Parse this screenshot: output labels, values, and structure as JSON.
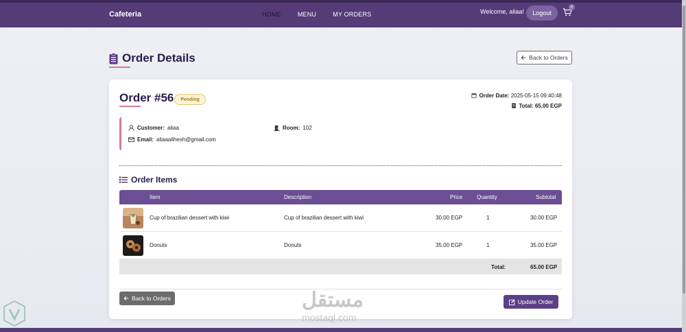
{
  "nav": {
    "brand": "Cafeteria",
    "links": [
      "HOME",
      "MENU",
      "MY ORDERS"
    ],
    "welcome": "Welcome, aliaa!",
    "logout": "Logout",
    "cart_count": "0"
  },
  "page": {
    "title": "Order Details",
    "back_label": "Back to Orders"
  },
  "order": {
    "title": "Order #56",
    "status": "Pending",
    "date_label": "Order Date:",
    "date_value": "2025-05-15 09:40:48",
    "total_label": "Total:",
    "total_value": "65.00 EGP",
    "customer_label": "Customer:",
    "customer_value": "aliaa",
    "room_label": "Room:",
    "room_value": "102",
    "email_label": "Email:",
    "email_value": "aliaaalihesh@gmail.com"
  },
  "items_section": {
    "title": "Order Items",
    "headers": [
      "Item",
      "Description",
      "Price",
      "Quantity",
      "Subtotal"
    ],
    "rows": [
      {
        "name": "Cup of brazilian dessert with kiwi",
        "description": "Cup of brazilian dessert with kiwi",
        "price": "30.00 EGP",
        "quantity": "1",
        "subtotal": "30.00 EGP"
      },
      {
        "name": "Donuts",
        "description": "Donuts",
        "price": "35.00 EGP",
        "quantity": "1",
        "subtotal": "35.00 EGP"
      }
    ],
    "total_label": "Total:",
    "total_value": "65.00 EGP"
  },
  "actions": {
    "back_label": "Back to Orders",
    "update_label": "Update Order"
  },
  "watermark": {
    "text": "مستقل",
    "sub": "mostaql.com"
  },
  "colors": {
    "navbar": "#553b78",
    "accent": "#d97a9a",
    "table_header": "#6b4e93",
    "update_button": "#5d3f88",
    "status_badge": "#fdf3d8"
  }
}
